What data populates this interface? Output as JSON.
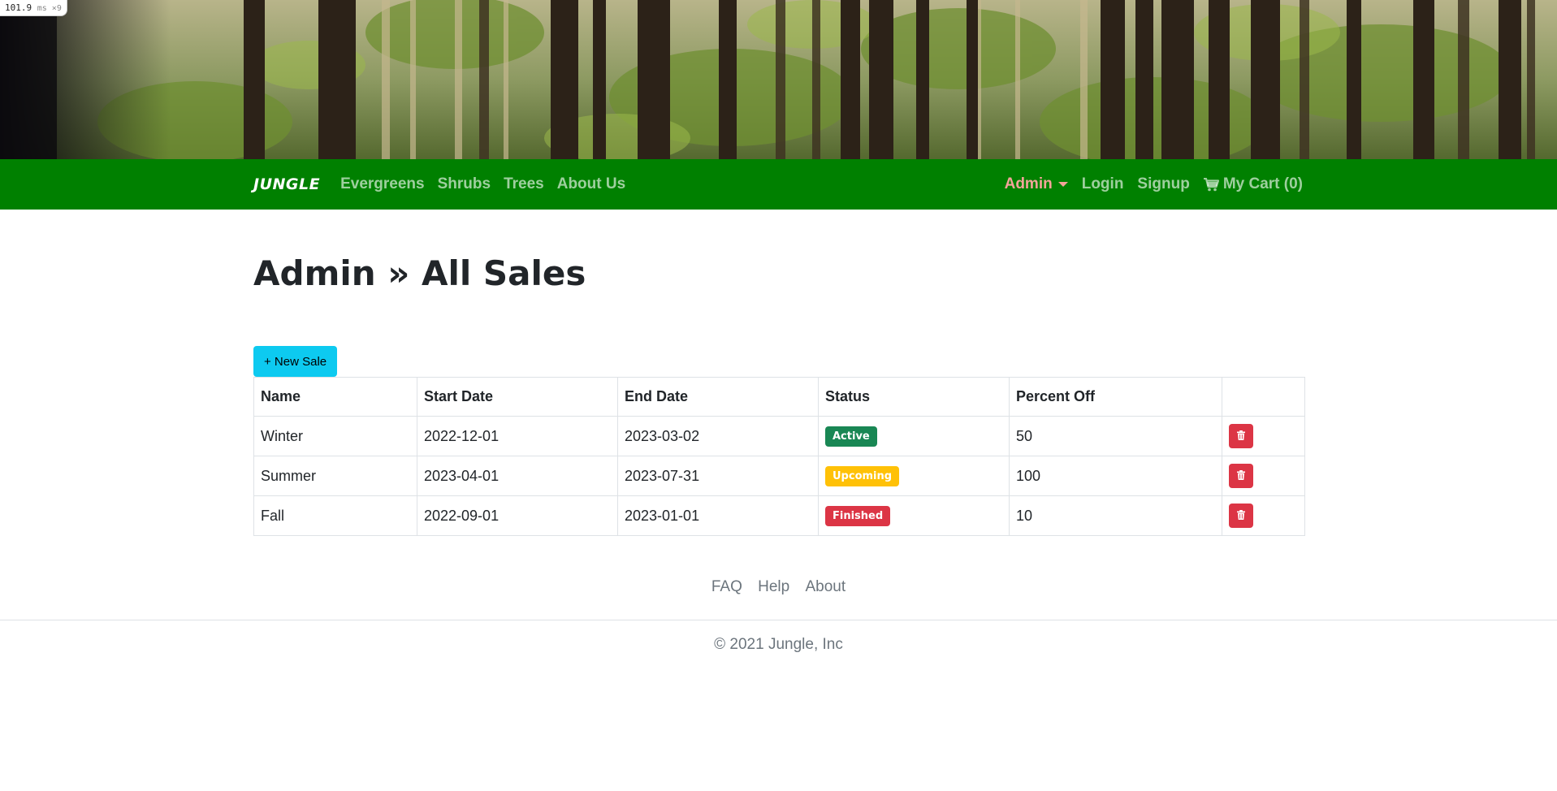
{
  "perf": {
    "value": "101.9",
    "unit": "ms ×9"
  },
  "navbar": {
    "brand": "JUNGLE",
    "links": [
      "Evergreens",
      "Shrubs",
      "Trees",
      "About Us"
    ],
    "admin_label": "Admin",
    "login_label": "Login",
    "signup_label": "Signup",
    "cart_label": "My Cart (0)",
    "bg_color": "#008000",
    "admin_color": "#f4a49a"
  },
  "main": {
    "title": "Admin » All Sales",
    "new_sale_label": "+ New Sale",
    "table": {
      "headers": [
        "Name",
        "Start Date",
        "End Date",
        "Status",
        "Percent Off",
        ""
      ],
      "rows": [
        {
          "name": "Winter",
          "start": "2022-12-01",
          "end": "2023-03-02",
          "status": "Active",
          "status_color": "#198754",
          "percent": "50"
        },
        {
          "name": "Summer",
          "start": "2023-04-01",
          "end": "2023-07-31",
          "status": "Upcoming",
          "status_color": "#ffc107",
          "percent": "100"
        },
        {
          "name": "Fall",
          "start": "2022-09-01",
          "end": "2023-01-01",
          "status": "Finished",
          "status_color": "#dc3545",
          "percent": "10"
        }
      ],
      "delete_icon": "trash-icon"
    }
  },
  "footer": {
    "links": [
      "FAQ",
      "Help",
      "About"
    ],
    "copyright": "© 2021 Jungle, Inc"
  }
}
